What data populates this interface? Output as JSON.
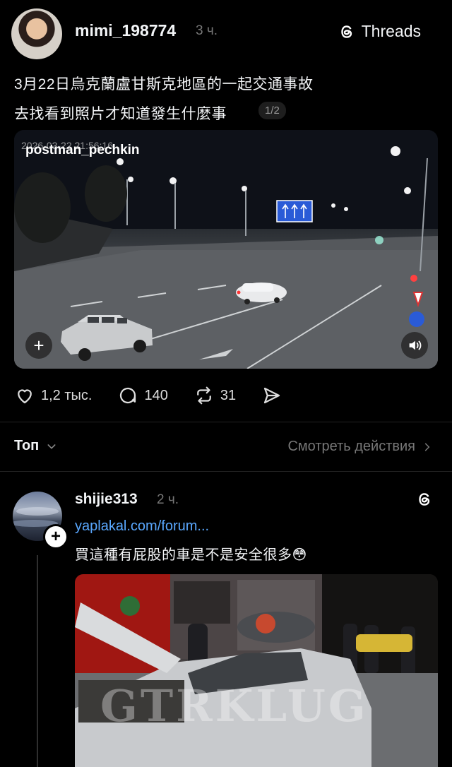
{
  "post": {
    "username": "mimi_198774",
    "time": "3 ч.",
    "app_label": "Threads",
    "caption_line1": "3月22日烏克蘭盧甘斯克地區的一起交通事故",
    "caption_line2": "去找看到照片才知道發生什麼事",
    "pager": "1/2",
    "video": {
      "camera_timestamp": "2026-03-22 21:56:16",
      "watermark_name": "postman_pechkin"
    },
    "stats": {
      "likes": "1,2 тыс.",
      "comments": "140",
      "reposts": "31"
    }
  },
  "sort": {
    "label": "Топ",
    "activity_label": "Смотреть действия"
  },
  "reply": {
    "username": "shijie313",
    "time": "2 ч.",
    "link": "yaplakal.com/forum...",
    "text": "買這種有屁股的車是不是安全很多😳",
    "photo_watermark": "GTRKLUG"
  },
  "colors": {
    "background": "#000000",
    "link": "#5aa8ff",
    "muted": "#777777"
  }
}
